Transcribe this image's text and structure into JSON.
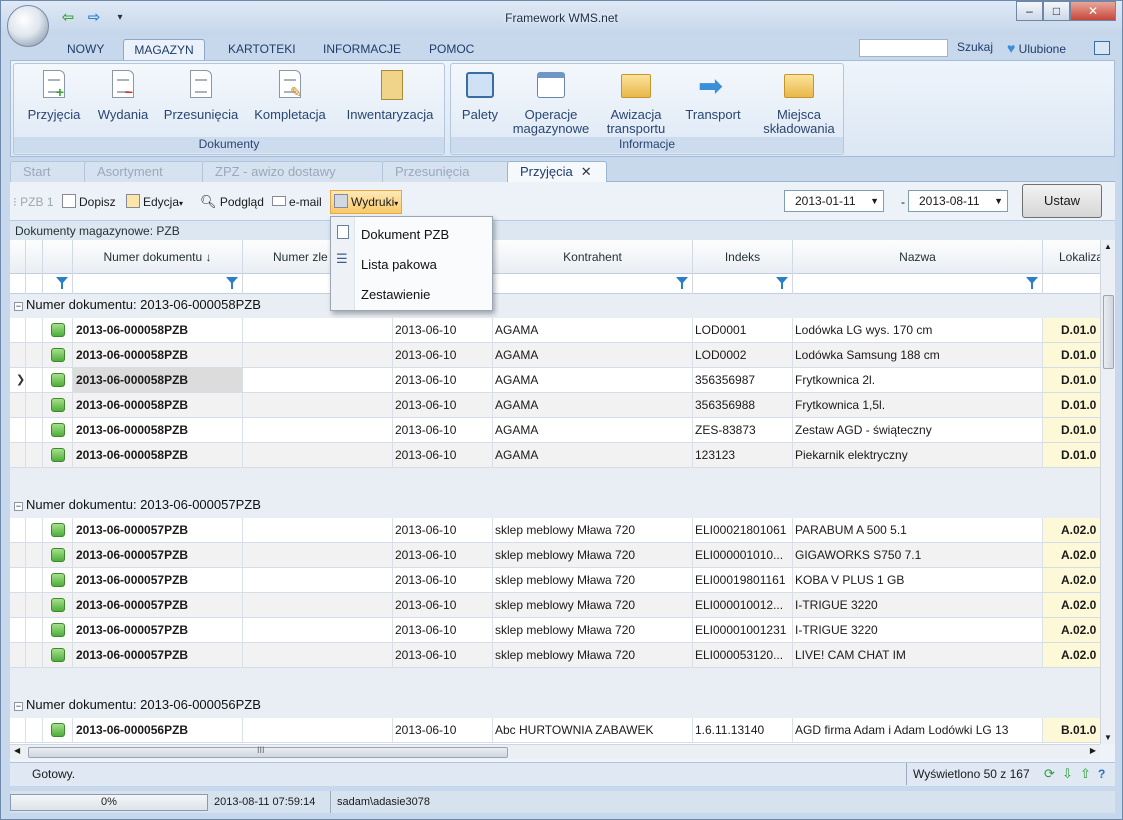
{
  "window": {
    "title": "Framework WMS.net",
    "min": "–",
    "max": "□",
    "close": "✕"
  },
  "qat": {
    "back": "⇦",
    "forward": "⇨",
    "more": "▾"
  },
  "ribbon_tabs": [
    "NOWY",
    "MAGAZYN",
    "KARTOTEKI",
    "INFORMACJE",
    "POMOC"
  ],
  "search": {
    "value": "",
    "label": "Szukaj"
  },
  "favorites": "Ulubione",
  "groups": {
    "dokumenty": "Dokumenty",
    "informacje": "Informacje"
  },
  "buttons": {
    "przyjecia": "Przyjęcia",
    "wydania": "Wydania",
    "przesuniecia": "Przesunięcia",
    "kompletacja": "Kompletacja",
    "inwentaryzacja": "Inwentaryzacja",
    "palety": "Palety",
    "operacje1": "Operacje",
    "operacje2": "magazynowe",
    "awizacja1": "Awizacja",
    "awizacja2": "transportu",
    "transport": "Transport",
    "miejsca1": "Miejsca",
    "miejsca2": "składowania"
  },
  "doc_tabs": [
    "Start",
    "Asortyment",
    "ZPZ - awizo dostawy",
    "Przesunięcia",
    "Przyjęcia"
  ],
  "tab_close": "✕",
  "toolbar": {
    "pzb": "PZB",
    "pzb_count": "1",
    "dopisz": "Dopisz",
    "edycja": "Edycja",
    "podglad": "Podgląd",
    "email": "e-mail",
    "wydruki": "Wydruki",
    "date_from": "2013-01-11",
    "date_to": "2013-08-11",
    "dash": "-",
    "ustaw": "Ustaw"
  },
  "breadcrumb": "Dokumenty magazynowe: PZB",
  "columns": [
    "Numer dokumentu ↓",
    "Numer zle",
    "Kontrahent",
    "Indeks",
    "Nazwa",
    "Lokalizacj"
  ],
  "dropdown": [
    "Dokument PZB",
    "Lista pakowa",
    "Zestawienie"
  ],
  "groups_data": [
    {
      "label": "Numer dokumentu: 2013-06-000058PZB",
      "rows": [
        [
          "2013-06-000058PZB",
          "",
          "2013-06-10",
          "AGAMA",
          "LOD0001",
          "Lodówka LG wys. 170 cm",
          "D.01.0"
        ],
        [
          "2013-06-000058PZB",
          "",
          "2013-06-10",
          "AGAMA",
          "LOD0002",
          "Lodówka Samsung 188 cm",
          "D.01.0"
        ],
        [
          "2013-06-000058PZB",
          "",
          "2013-06-10",
          "AGAMA",
          "356356987",
          "Frytkownica 2l.",
          "D.01.0"
        ],
        [
          "2013-06-000058PZB",
          "",
          "2013-06-10",
          "AGAMA",
          "356356988",
          "Frytkownica 1,5l.",
          "D.01.0"
        ],
        [
          "2013-06-000058PZB",
          "",
          "2013-06-10",
          "AGAMA",
          "ZES-83873",
          "Zestaw AGD - świąteczny",
          "D.01.0"
        ],
        [
          "2013-06-000058PZB",
          "",
          "2013-06-10",
          "AGAMA",
          "123123",
          "Piekarnik elektryczny",
          "D.01.0"
        ]
      ]
    },
    {
      "label": "Numer dokumentu: 2013-06-000057PZB",
      "rows": [
        [
          "2013-06-000057PZB",
          "",
          "2013-06-10",
          "sklep meblowy Mława 720",
          "ELI00021801061",
          "PARABUM A 500 5.1",
          "A.02.0"
        ],
        [
          "2013-06-000057PZB",
          "",
          "2013-06-10",
          "sklep meblowy Mława 720",
          "ELI000001010...",
          "GIGAWORKS S750 7.1",
          "A.02.0"
        ],
        [
          "2013-06-000057PZB",
          "",
          "2013-06-10",
          "sklep meblowy Mława 720",
          "ELI00019801161",
          "KOBA V PLUS 1 GB",
          "A.02.0"
        ],
        [
          "2013-06-000057PZB",
          "",
          "2013-06-10",
          "sklep meblowy Mława 720",
          "ELI000010012...",
          "I-TRIGUE 3220",
          "A.02.0"
        ],
        [
          "2013-06-000057PZB",
          "",
          "2013-06-10",
          "sklep meblowy Mława 720",
          "ELI00001001231",
          "I-TRIGUE 3220",
          "A.02.0"
        ],
        [
          "2013-06-000057PZB",
          "",
          "2013-06-10",
          "sklep meblowy Mława 720",
          "ELI000053120...",
          "LIVE! CAM CHAT IM",
          "A.02.0"
        ]
      ]
    },
    {
      "label": "Numer dokumentu: 2013-06-000056PZB",
      "rows": [
        [
          "2013-06-000056PZB",
          "",
          "2013-06-10",
          "Abc HURTOWNIA ZABAWEK",
          "1.6.11.13140",
          "AGD firma Adam i Adam Lodówki LG 13",
          "B.01.0"
        ]
      ]
    }
  ],
  "status": {
    "left": "Gotowy.",
    "count": "Wyświetlono 50 z 167",
    "progress": "0%",
    "datetime": "2013-08-11 07:59:14",
    "user": "sadam\\adasie3078"
  },
  "hscroll_grip": "III"
}
